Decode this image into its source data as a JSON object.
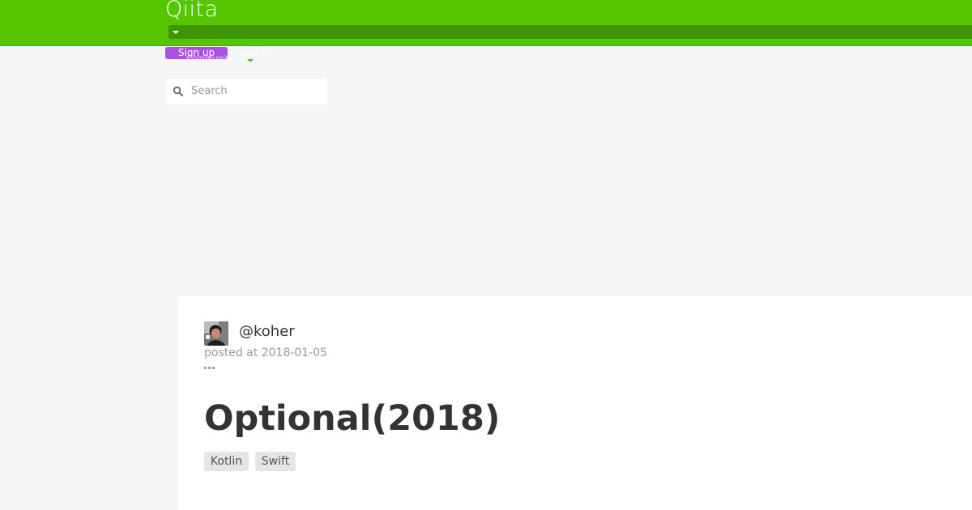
{
  "header": {
    "logo_text": "Qiita",
    "brand_color": "#55c500",
    "dropdown_icon": "caret-down-icon",
    "signup_label": "Sign up",
    "signup_color": "#a950e0",
    "login_label": "Log in",
    "community_label": "Community",
    "search": {
      "icon": "search-icon",
      "value": "",
      "placeholder": "Search"
    }
  },
  "article": {
    "author": {
      "name": "@koher",
      "avatar_alt": "koher"
    },
    "posted_label": "posted at",
    "posted_date": "2018-01-05",
    "more_icon": "more-dots-icon",
    "title": "Optional(2018)",
    "tags": [
      "Kotlin",
      "Swift"
    ]
  }
}
